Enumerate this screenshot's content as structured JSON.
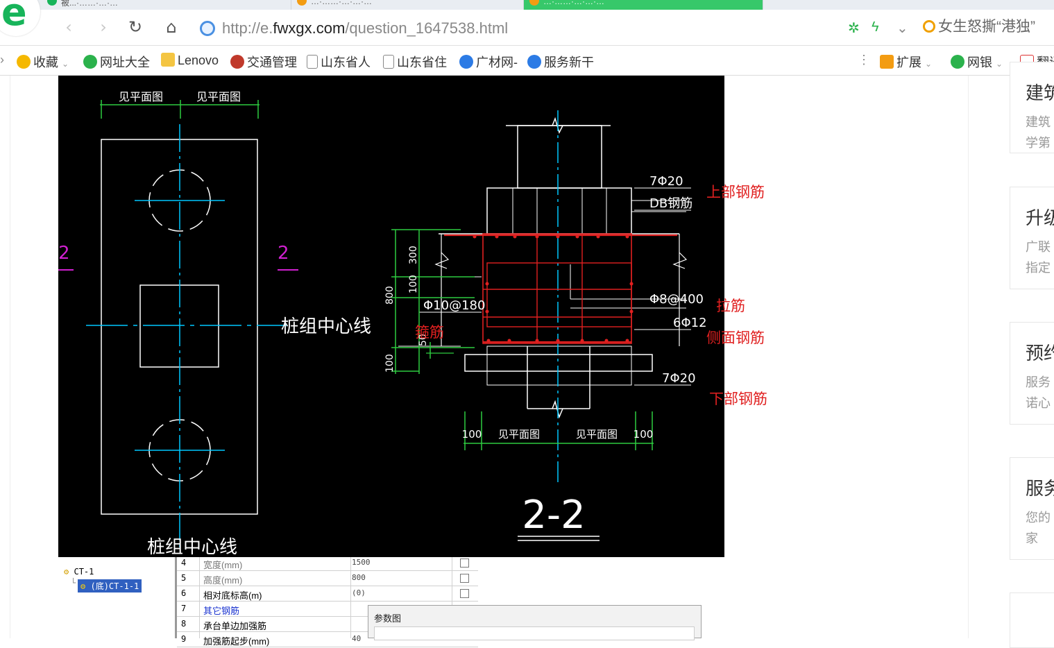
{
  "tabs": [
    {
      "label": "被...·……·…·…"
    },
    {
      "label": "…·……·…·…·…"
    },
    {
      "label": "…·……·…·…·…"
    }
  ],
  "nav": {
    "back": "‹",
    "forward": "›",
    "reload": "↻",
    "home": "⌂"
  },
  "address": {
    "prefix": "http://e.",
    "domain": "fwxgx.com",
    "path": "/question_1647538.html"
  },
  "news": "女生怒撕“港独”",
  "bookmarks": [
    {
      "label": "收藏",
      "icon": "star-icon",
      "color": "#f5b800"
    },
    {
      "label": "网址大全",
      "icon": "plus-circle-icon",
      "color": "#f5b800"
    },
    {
      "label": "Lenovo",
      "icon": "folder-icon",
      "color": "#f4c542"
    },
    {
      "label": "交通管理",
      "icon": "police-badge-icon",
      "color": "#c0392b"
    },
    {
      "label": "山东省人",
      "icon": "page-icon",
      "color": "#ffffff"
    },
    {
      "label": "山东省住",
      "icon": "page-icon",
      "color": "#ffffff"
    },
    {
      "label": "广材网-",
      "icon": "g-logo-icon",
      "color": "#2c7be5"
    },
    {
      "label": "服务新干",
      "icon": "service-icon",
      "color": "#2c7be5"
    }
  ],
  "toolbar_right": [
    {
      "label": "扩展",
      "icon": "extension-icon"
    },
    {
      "label": "网银",
      "icon": "shield-icon"
    },
    {
      "label": "翻译",
      "icon": "pdf-icon"
    }
  ],
  "cad": {
    "top_dim_left": "见平面图",
    "top_dim_right": "见平面图",
    "section_mark_left": "2",
    "section_mark_right": "2",
    "pile_centerline_right": "桩组中心线",
    "pile_centerline_bottom": "桩组中心线",
    "label_top_bars": "7Φ20",
    "label_db": "DB钢筋",
    "label_stirrup": "Φ10@180",
    "label_tie": "Φ8@400",
    "label_side": "6Φ12",
    "label_bottom_bars": "7Φ20",
    "dim_300": "300",
    "dim_100a": "100",
    "dim_800": "800",
    "dim_50": "50",
    "dim_100b": "100",
    "bottom_dim_100_left": "100",
    "bottom_dim_left": "见平面图",
    "bottom_dim_right": "见平面图",
    "bottom_dim_100_right": "100",
    "section_title": "2-2"
  },
  "annotations": {
    "top_rebar": "上部钢筋",
    "tie_bar": "拉筋",
    "stirrup": "箍筋",
    "side_rebar": "侧面钢筋",
    "bottom_rebar": "下部钢筋"
  },
  "cards": [
    {
      "title": "建筑",
      "sub1": "建筑",
      "sub2": "学第"
    },
    {
      "title": "升级",
      "sub1": "广联",
      "sub2": "指定"
    },
    {
      "title": "预约",
      "sub1": "服务",
      "sub2": "诺心"
    },
    {
      "title": "服务",
      "sub1": "您的",
      "sub2": "家"
    }
  ],
  "tree": {
    "item1": "CT-1",
    "item2": "(底)CT-1-1"
  },
  "params": [
    {
      "n": "4",
      "name": "宽度(mm)",
      "val": "1500",
      "blue": false
    },
    {
      "n": "5",
      "name": "高度(mm)",
      "val": "800",
      "blue": false
    },
    {
      "n": "6",
      "name": "相对底标高(m)",
      "val": "(0)",
      "blue": false
    },
    {
      "n": "7",
      "name": "其它钢筋",
      "val": "",
      "blue": true
    },
    {
      "n": "8",
      "name": "承台单边加强筋",
      "val": "",
      "blue": false
    },
    {
      "n": "9",
      "name": "加强筋起步(mm)",
      "val": "40",
      "blue": false
    }
  ],
  "dialog": {
    "title": "参数图"
  }
}
